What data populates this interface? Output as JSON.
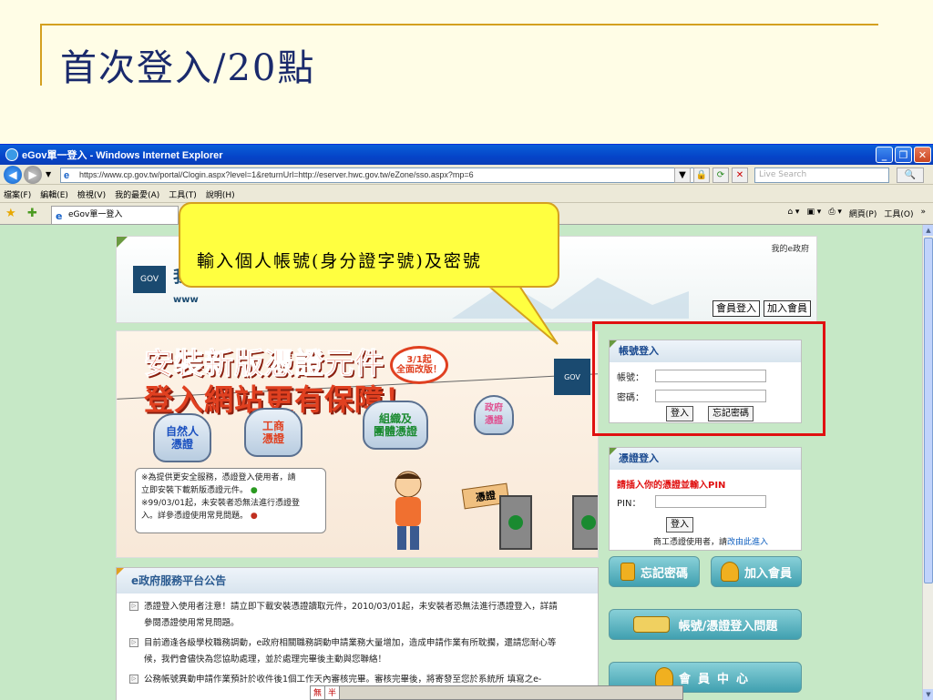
{
  "slide": {
    "title": "首次登入/20點"
  },
  "browser": {
    "window_title": "eGov單一登入 - Windows Internet Explorer",
    "address": "https://www.cp.gov.tw/portal/Clogin.aspx?level=1&returnUrl=http://eserver.hwc.gov.tw/eZone/sso.aspx?mp=6",
    "search_placeholder": "Live Search",
    "menu": [
      "檔案(F)",
      "編輯(E)",
      "檢視(V)",
      "我的最愛(A)",
      "工具(T)",
      "說明(H)"
    ],
    "tab_label": "eGov單一登入",
    "command_bar": [
      "網頁(P)",
      "工具(O)"
    ]
  },
  "site": {
    "logo_text": "我的",
    "logo_sub": "www",
    "my_egov": "我的e政府",
    "member_login": "會員登入",
    "join_member": "加入會員"
  },
  "banner": {
    "line1": "安裝新版憑證元件",
    "line2": "登入網站更有保障！",
    "badge": "3/1起\n全面改版！",
    "gondola_natural": "自然人\n憑證",
    "gondola_business": "工商\n憑證",
    "gondola_org": "組織及\n團體憑證",
    "gondola_gov": "政府\n憑證",
    "gov_sign": "GOV",
    "cert_card": "憑證",
    "notice_lines": [
      "※為提供更安全服務，憑證登入使用者，請",
      "立即安裝下載新版憑證元件。",
      "※99/03/01起，未安裝者恐無法進行憑證登",
      "入。詳參憑證使用常見問題。"
    ]
  },
  "account_login": {
    "title": "帳號登入",
    "account_label": "帳號：",
    "password_label": "密碼：",
    "login_button": "登入",
    "forgot_button": "忘記密碼"
  },
  "cert_login": {
    "title": "憑證登入",
    "warning": "請插入你的憑證並輸入PIN",
    "pin_label": "PIN：",
    "login_button": "登入",
    "note": "商工憑證使用者，請",
    "note_link": "改由此進入"
  },
  "side_buttons": {
    "forgot_password": "忘記密碼",
    "join_member": "加入會員",
    "account_cert_faq": "帳號/憑證登入問題",
    "member_center": "會員中心"
  },
  "announcements": {
    "title": "e政府服務平台公告",
    "items": [
      "憑證登入使用者注意！請立即下載安裝憑證讀取元件，2010/03/01起，未安裝者恐無法進行憑證登入，詳請",
      "參閱憑證使用常見問題。",
      "目前適逢各級學校職務調動，e政府相關職務調動申請業務大量增加，造成申請作業有所耽擱，還請您耐心等",
      "候，我們會儘快為您協助處理，並於處理完畢後主動與您聯絡！",
      "公務帳號異動申請作業預計於收件後1個工作天內審核完畢。審核完畢後，將寄發至您於系統所 填寫之e-"
    ]
  },
  "ime": {
    "mode1": "無",
    "mode2": "半"
  },
  "callout": {
    "text": "輸入個人帳號(身分證字號)及密號"
  },
  "colors": {
    "slide_bg": "#fffde6",
    "title_color": "#1a2a6c",
    "page_bg": "#c6e8c6",
    "highlight_red": "#e01010",
    "callout_yellow": "#ffff40"
  }
}
